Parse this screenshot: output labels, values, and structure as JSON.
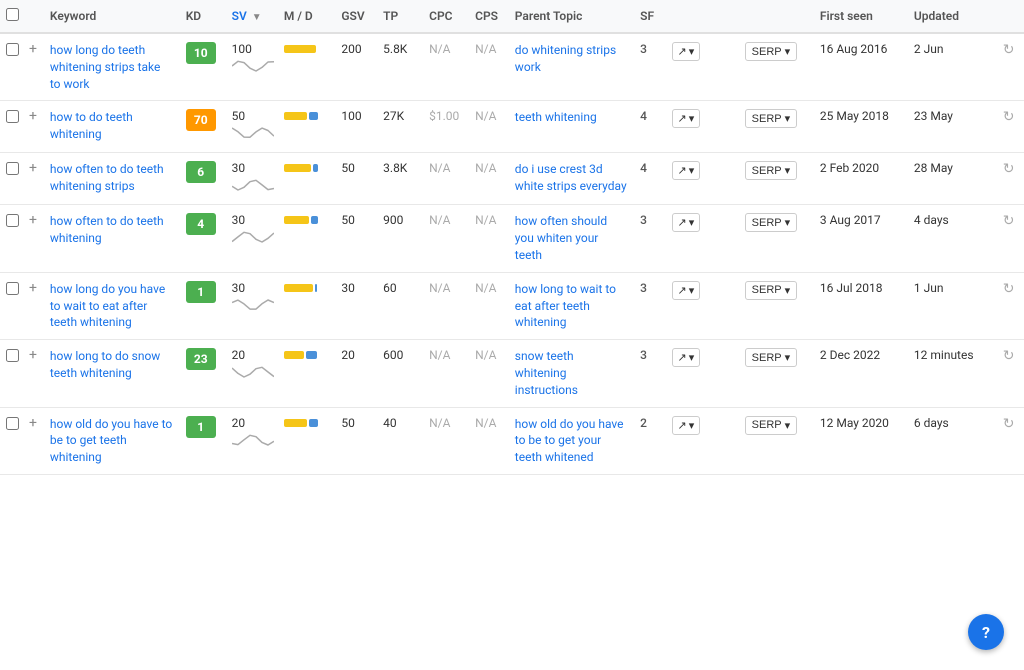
{
  "header": {
    "columns": [
      {
        "key": "check",
        "label": ""
      },
      {
        "key": "plus",
        "label": ""
      },
      {
        "key": "keyword",
        "label": "Keyword"
      },
      {
        "key": "kd",
        "label": "KD"
      },
      {
        "key": "sv",
        "label": "SV",
        "sorted": true,
        "sort_dir": "desc"
      },
      {
        "key": "md",
        "label": "M / D"
      },
      {
        "key": "gsv",
        "label": "GSV"
      },
      {
        "key": "tp",
        "label": "TP"
      },
      {
        "key": "cpc",
        "label": "CPC"
      },
      {
        "key": "cps",
        "label": "CPS"
      },
      {
        "key": "parent",
        "label": "Parent Topic"
      },
      {
        "key": "sf",
        "label": "SF"
      },
      {
        "key": "trend",
        "label": ""
      },
      {
        "key": "serp",
        "label": ""
      },
      {
        "key": "first",
        "label": "First seen"
      },
      {
        "key": "updated",
        "label": "Updated"
      },
      {
        "key": "refresh",
        "label": ""
      }
    ]
  },
  "rows": [
    {
      "keyword": "how long do teeth whitening strips take to work",
      "kd": 10,
      "kd_color": "green",
      "sv": 100,
      "gsv": 200,
      "tp": "5.8K",
      "cpc": "N/A",
      "cps": "N/A",
      "parent_topic": "do whitening strips work",
      "sf": 3,
      "first_seen": "16 Aug 2016",
      "updated": "2 Jun",
      "md_yellow": 14,
      "md_blue": 0
    },
    {
      "keyword": "how to do teeth whitening",
      "kd": 70,
      "kd_color": "orange",
      "sv": 50,
      "gsv": 100,
      "tp": "27K",
      "cpc": "$1.00",
      "cps": "N/A",
      "parent_topic": "teeth whitening",
      "sf": 4,
      "first_seen": "25 May 2018",
      "updated": "23 May",
      "md_yellow": 10,
      "md_blue": 4
    },
    {
      "keyword": "how often to do teeth whitening strips",
      "kd": 6,
      "kd_color": "green",
      "sv": 30,
      "gsv": 50,
      "tp": "3.8K",
      "cpc": "N/A",
      "cps": "N/A",
      "parent_topic": "do i use crest 3d white strips everyday",
      "sf": 4,
      "first_seen": "2 Feb 2020",
      "updated": "28 May",
      "md_yellow": 12,
      "md_blue": 2
    },
    {
      "keyword": "how often to do teeth whitening",
      "kd": 4,
      "kd_color": "green",
      "sv": 30,
      "gsv": 50,
      "tp": "900",
      "cpc": "N/A",
      "cps": "N/A",
      "parent_topic": "how often should you whiten your teeth",
      "sf": 3,
      "first_seen": "3 Aug 2017",
      "updated": "4 days",
      "md_yellow": 11,
      "md_blue": 3
    },
    {
      "keyword": "how long do you have to wait to eat after teeth whitening",
      "kd": 1,
      "kd_color": "green",
      "sv": 30,
      "gsv": 30,
      "tp": "60",
      "cpc": "N/A",
      "cps": "N/A",
      "parent_topic": "how long to wait to eat after teeth whitening",
      "sf": 3,
      "first_seen": "16 Jul 2018",
      "updated": "1 Jun",
      "md_yellow": 13,
      "md_blue": 1
    },
    {
      "keyword": "how long to do snow teeth whitening",
      "kd": 23,
      "kd_color": "green",
      "sv": 20,
      "gsv": 20,
      "tp": "600",
      "cpc": "N/A",
      "cps": "N/A",
      "parent_topic": "snow teeth whitening instructions",
      "sf": 3,
      "first_seen": "2 Dec 2022",
      "updated": "12 minutes",
      "md_yellow": 9,
      "md_blue": 5
    },
    {
      "keyword": "how old do you have to be to get teeth whitening",
      "kd": 1,
      "kd_color": "green",
      "sv": 20,
      "gsv": 50,
      "tp": "40",
      "cpc": "N/A",
      "cps": "N/A",
      "parent_topic": "how old do you have to be to get your teeth whitened",
      "sf": 2,
      "first_seen": "12 May 2020",
      "updated": "6 days",
      "md_yellow": 10,
      "md_blue": 4
    }
  ],
  "ui": {
    "serp_label": "SERP",
    "trend_symbol": "↗",
    "dropdown_arrow": "▾",
    "refresh_symbol": "↻",
    "plus_symbol": "+",
    "help_symbol": "?",
    "na_label": "N/A"
  },
  "colors": {
    "green": "#4caf50",
    "orange": "#ff9800",
    "blue": "#2196f3",
    "accent": "#1a73e8"
  }
}
